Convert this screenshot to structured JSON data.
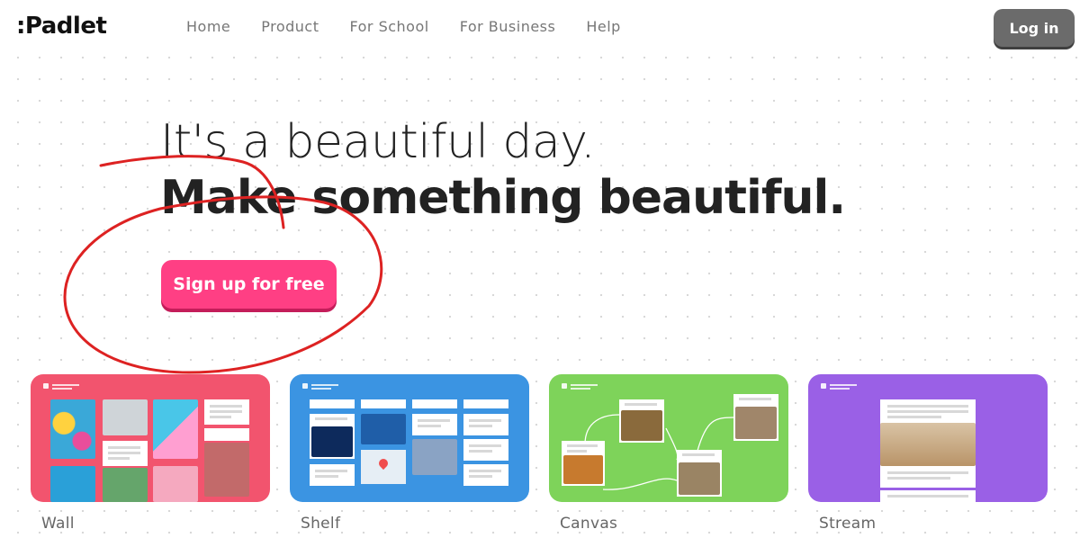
{
  "brand": {
    "logo": ":Padlet"
  },
  "nav": {
    "items": [
      "Home",
      "Product",
      "For School",
      "For Business",
      "Help"
    ],
    "login": "Log in"
  },
  "hero": {
    "line1": "It's a beautiful day.",
    "line2": "Make something beautiful.",
    "cta": "Sign up for free"
  },
  "layouts": [
    {
      "name": "Wall",
      "color": "#f2546e"
    },
    {
      "name": "Shelf",
      "color": "#3b94e2"
    },
    {
      "name": "Canvas",
      "color": "#7ed35a"
    },
    {
      "name": "Stream",
      "color": "#9a60e6"
    }
  ],
  "colors": {
    "cta": "#ff3f84",
    "scribble": "#dd2222",
    "login": "#6b6b6b"
  }
}
